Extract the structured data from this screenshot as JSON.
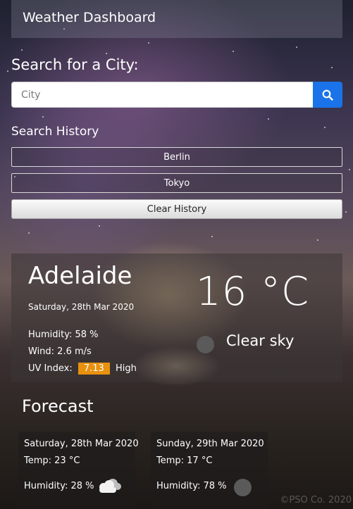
{
  "header": {
    "title": "Weather Dashboard"
  },
  "search": {
    "label": "Search for a City:",
    "placeholder": "City",
    "button_icon": "search-icon"
  },
  "history": {
    "label": "Search History",
    "items": [
      "Berlin",
      "Tokyo"
    ],
    "clear_label": "Clear History"
  },
  "current": {
    "city": "Adelaide",
    "date": "Saturday, 28th Mar 2020",
    "temperature": "16 °C",
    "humidity": "Humidity: 58 %",
    "wind": "Wind: 2.6 m/s",
    "uv_label": "UV Index:",
    "uv_value": "7.13",
    "uv_level": "High",
    "uv_color": "#e8910f",
    "condition": "Clear sky",
    "condition_icon": "moon-icon"
  },
  "forecast": {
    "title": "Forecast",
    "days": [
      {
        "date": "Saturday, 28th Mar 2020",
        "temp": "Temp: 23 °C",
        "humidity": "Humidity: 28 %",
        "icon": "clouds-icon"
      },
      {
        "date": "Sunday, 29th Mar 2020",
        "temp": "Temp: 17 °C",
        "humidity": "Humidity: 78 %",
        "icon": "moon-icon"
      }
    ]
  },
  "footer": {
    "text": "©PSO Co. 2020"
  },
  "colors": {
    "accent": "#1a73e8",
    "uv_high": "#e8910f"
  }
}
